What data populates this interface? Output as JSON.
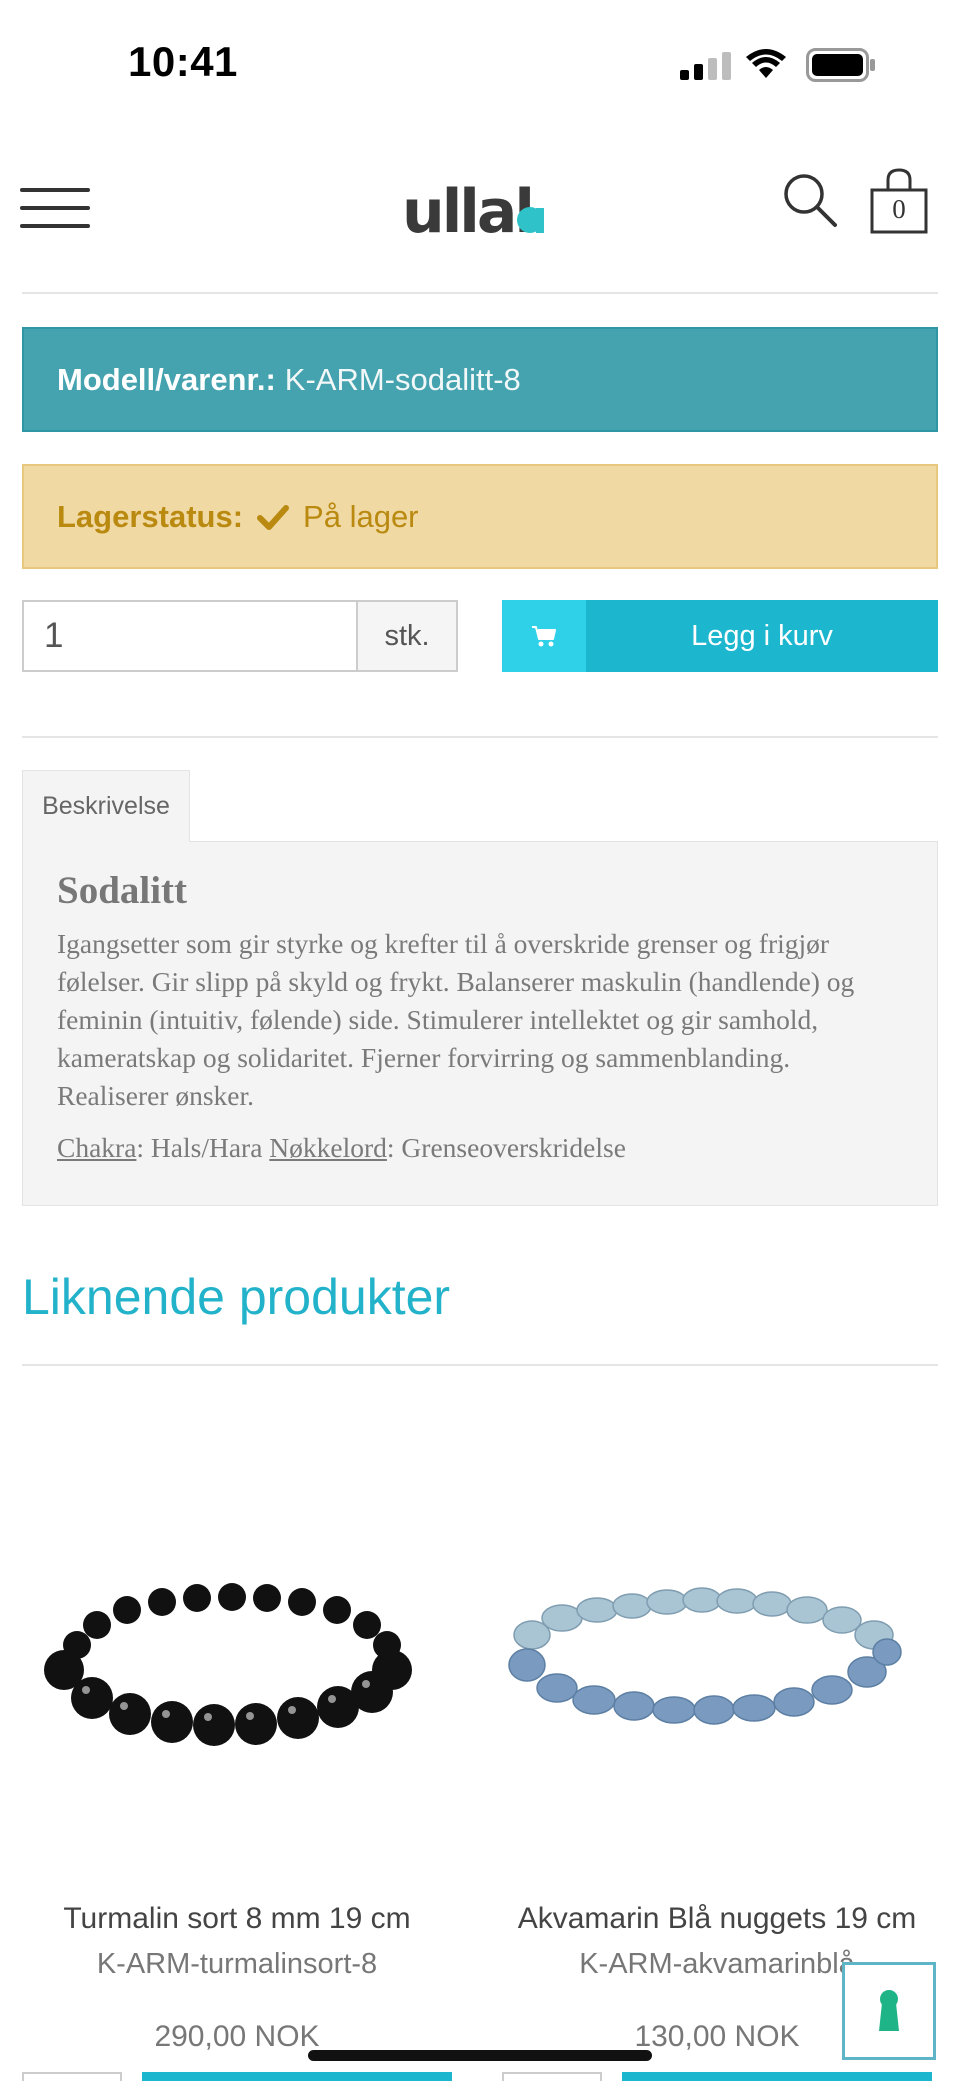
{
  "status_bar": {
    "time": "10:41"
  },
  "header": {
    "logo_text": "ullala",
    "cart_count": "0",
    "brand_color": "#2fc3c9"
  },
  "product": {
    "model_label": "Modell/varenr.:",
    "model_value": "K-ARM-sodalitt-8",
    "stock_label": "Lagerstatus:",
    "stock_value": "På lager",
    "quantity": "1",
    "quantity_unit": "stk.",
    "add_to_cart_label": "Legg i kurv"
  },
  "tabs": [
    {
      "label": "Beskrivelse"
    }
  ],
  "description": {
    "title": "Sodalitt",
    "body": "Igangsetter som gir styrke og krefter til å overskride grenser og frigjør følelser. Gir slipp på skyld og frykt. Balanserer maskulin (handlende) og feminin (intuitiv, følende) side. Stimulerer intellektet og gir samhold, kameratskap og solidaritet. Fjerner forvirring og sammenblanding. Realiserer ønsker.",
    "chakra_label": "Chakra",
    "chakra_value": ": Hals/Hara ",
    "keyword_label": "Nøkkelord",
    "keyword_value": ": Grenseoverskridelse"
  },
  "related": {
    "title": "Liknende produkter",
    "products": [
      {
        "name": "Turmalin sort 8 mm 19 cm",
        "sku": "K-ARM-turmalinsort-8",
        "price": "290,00 NOK",
        "image": "black-bead-bracelet"
      },
      {
        "name": "Akvamarin Blå nuggets 19 cm",
        "sku": "K-ARM-akvamarinblå",
        "price": "130,00 NOK",
        "image": "blue-nugget-bracelet"
      }
    ]
  },
  "colors": {
    "model_bg": "#44a3af",
    "stock_bg": "#f0d9a3",
    "stock_text": "#b98910",
    "accent": "#1cb7cf"
  }
}
